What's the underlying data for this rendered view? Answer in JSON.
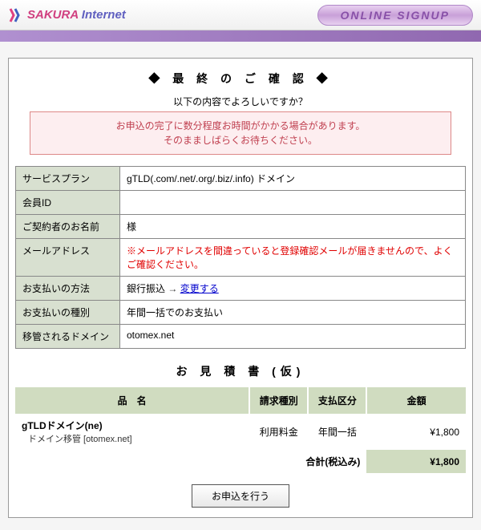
{
  "header": {
    "logo_sakura": "SAKURA",
    "logo_internet": " Internet",
    "signup_label": "ONLINE SIGNUP"
  },
  "section_title": "◆ 最 終 の ご 確 認 ◆",
  "prompt": "以下の内容でよろしいですか？",
  "notice_line1": "お申込の完了に数分程度お時間がかかる場合があります。",
  "notice_line2": "そのまましばらくお待ちください。",
  "info": {
    "service_plan_label": "サービスプラン",
    "service_plan_value": "gTLD(.com/.net/.org/.biz/.info) ドメイン",
    "member_id_label": "会員ID",
    "member_id_value": " ",
    "contractor_label": "ご契約者のお名前",
    "contractor_value": "様",
    "email_label": "メールアドレス",
    "email_value": " ",
    "email_warning": "※メールアドレスを間違っていると登録確認メールが届きませんので、よくご確認ください。",
    "payment_method_label": "お支払いの方法",
    "payment_method_value": "銀行振込",
    "payment_change": "変更する",
    "payment_type_label": "お支払いの種別",
    "payment_type_value": "年間一括でのお支払い",
    "transfer_domain_label": "移管されるドメイン",
    "transfer_domain_value": "otomex.net"
  },
  "estimate": {
    "title": "お 見 積 書 (仮)",
    "col_name": "品　名",
    "col_billing": "請求種別",
    "col_payment": "支払区分",
    "col_amount": "金額",
    "item_name": "gTLDドメイン(ne)",
    "item_sub": "ドメイン移管 [otomex.net]",
    "item_billing": "利用料金",
    "item_payment": "年間一括",
    "item_amount": "¥1,800",
    "total_label": "合計(税込み)",
    "total_amount": "¥1,800"
  },
  "submit_label": "お申込を行う"
}
